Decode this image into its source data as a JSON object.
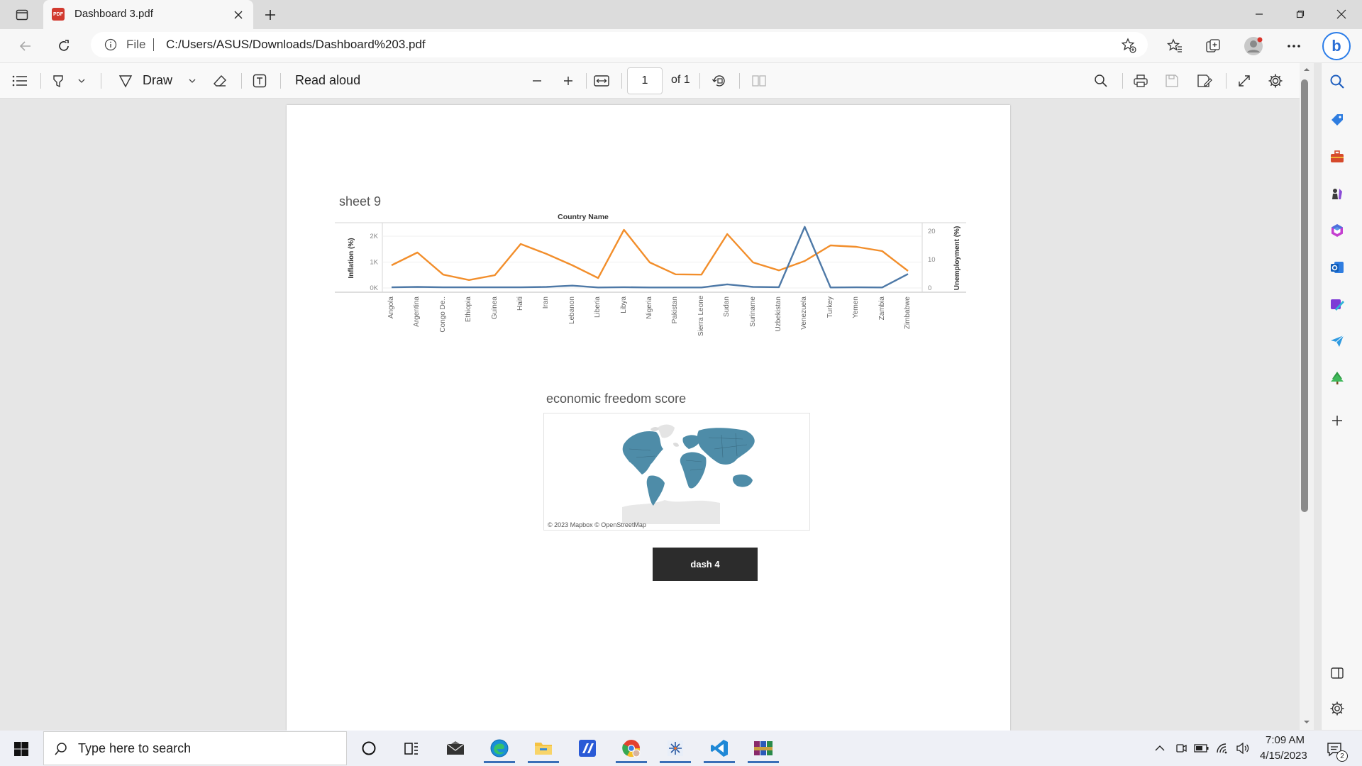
{
  "browser": {
    "tab_title": "Dashboard 3.pdf",
    "tab_icon": "pdf-icon",
    "url_prefix": "File",
    "url": "C:/Users/ASUS/Downloads/Dashboard%203.pdf"
  },
  "pdf_toolbar": {
    "draw_label": "Draw",
    "read_aloud_label": "Read aloud",
    "page_current": "1",
    "page_total": "of 1"
  },
  "document": {
    "chart_title": "sheet 9",
    "map_title": "economic freedom score",
    "map_attribution": "© 2023 Mapbox © OpenStreetMap",
    "dash_button_label": "dash 4"
  },
  "chart_data": {
    "type": "line",
    "title": "Country Name",
    "ylabel_left": "Inflation (%)",
    "ylabel_right": "Unemployment (%)",
    "y_left_ticks": [
      "2K",
      "1K",
      "0K"
    ],
    "y_right_ticks": [
      "20",
      "10",
      "0"
    ],
    "ylim_left": [
      0,
      2300
    ],
    "ylim_right": [
      0,
      21
    ],
    "categories": [
      "Angola",
      "Argentina",
      "Congo De..",
      "Ethiopia",
      "Guinea",
      "Haiti",
      "Iran",
      "Lebanon",
      "Liberia",
      "Libya",
      "Nigeria",
      "Pakistan",
      "Sierra Leone",
      "Sudan",
      "Suriname",
      "Uzbekistan",
      "Venezuela",
      "Turkey",
      "Yemen",
      "Zambia",
      "Zimbabwe"
    ],
    "series": [
      {
        "axis": "right",
        "color": "#f28e2b",
        "values": [
          8.0,
          12.5,
          4.7,
          2.8,
          4.5,
          15.5,
          12.0,
          8.0,
          3.5,
          20.5,
          9.0,
          4.8,
          4.7,
          19.0,
          9.0,
          6.2,
          9.5,
          15.0,
          14.5,
          13.0,
          6.0
        ]
      },
      {
        "axis": "left",
        "color": "#4e79a7",
        "values": [
          25,
          40,
          25,
          25,
          25,
          25,
          40,
          90,
          20,
          30,
          20,
          20,
          20,
          140,
          40,
          30,
          2360,
          20,
          25,
          20,
          540
        ]
      }
    ],
    "grid": true
  },
  "taskbar": {
    "search_placeholder": "Type here to search",
    "time": "7:09 AM",
    "date": "4/15/2023",
    "notification_count": "2"
  },
  "sidebar_icons": [
    "search-icon",
    "tag-icon",
    "briefcase-icon",
    "chess-icon",
    "office-icon",
    "outlook-icon",
    "designer-icon",
    "send-icon",
    "tree-icon",
    "add-icon"
  ]
}
